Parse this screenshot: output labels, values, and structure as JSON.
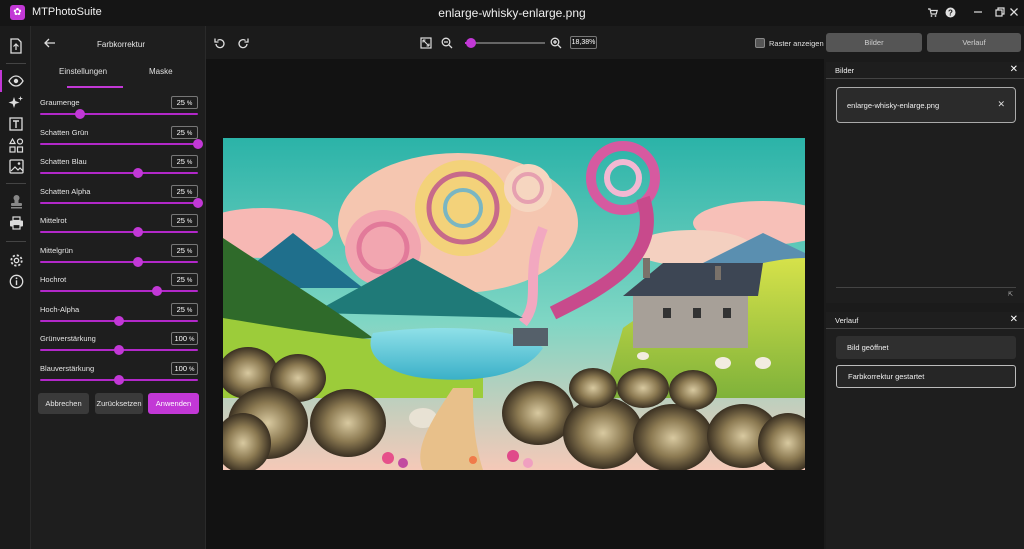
{
  "app": {
    "name": "MTPhotoSuite",
    "window_title": "enlarge-whisky-enlarge.png"
  },
  "panel": {
    "title": "Farbkorrektur",
    "tabs": [
      "Einstellungen",
      "Maske"
    ],
    "sliders": [
      {
        "label": "Graumenge",
        "value": "25",
        "unit": "%",
        "level": 0.25
      },
      {
        "label": "Schatten Grün",
        "value": "25",
        "unit": "%",
        "level": 1.0
      },
      {
        "label": "Schatten Blau",
        "value": "25",
        "unit": "%",
        "level": 0.62
      },
      {
        "label": "Schatten Alpha",
        "value": "25",
        "unit": "%",
        "level": 1.0
      },
      {
        "label": "Mittelrot",
        "value": "25",
        "unit": "%",
        "level": 0.62
      },
      {
        "label": "Mittelgrün",
        "value": "25",
        "unit": "%",
        "level": 0.62
      },
      {
        "label": "Hochrot",
        "value": "25",
        "unit": "%",
        "level": 0.74
      },
      {
        "label": "Hoch-Alpha",
        "value": "25",
        "unit": "%",
        "level": 0.5
      },
      {
        "label": "Grünverstärkung",
        "value": "100",
        "unit": "%",
        "level": 0.5
      },
      {
        "label": "Blauverstärkung",
        "value": "100",
        "unit": "%",
        "level": 0.5
      }
    ],
    "buttons": {
      "cancel": "Abbrechen",
      "reset": "Zurücksetzen",
      "apply": "Anwenden"
    }
  },
  "toolbar": {
    "zoom_value": "18,38%",
    "zoom_level": 0.08,
    "raster_label": "Raster anzeigen",
    "bilder_button": "Bilder",
    "verlauf_button": "Verlauf"
  },
  "images_panel": {
    "title": "Bilder",
    "files": [
      "enlarge-whisky-enlarge.png"
    ]
  },
  "history_panel": {
    "title": "Verlauf",
    "items": [
      "Bild geöffnet",
      "Farbkorrektur gestartet"
    ]
  },
  "colors": {
    "accent": "#c238d6",
    "background": "#1b1b1b",
    "canvas": "#121212"
  }
}
